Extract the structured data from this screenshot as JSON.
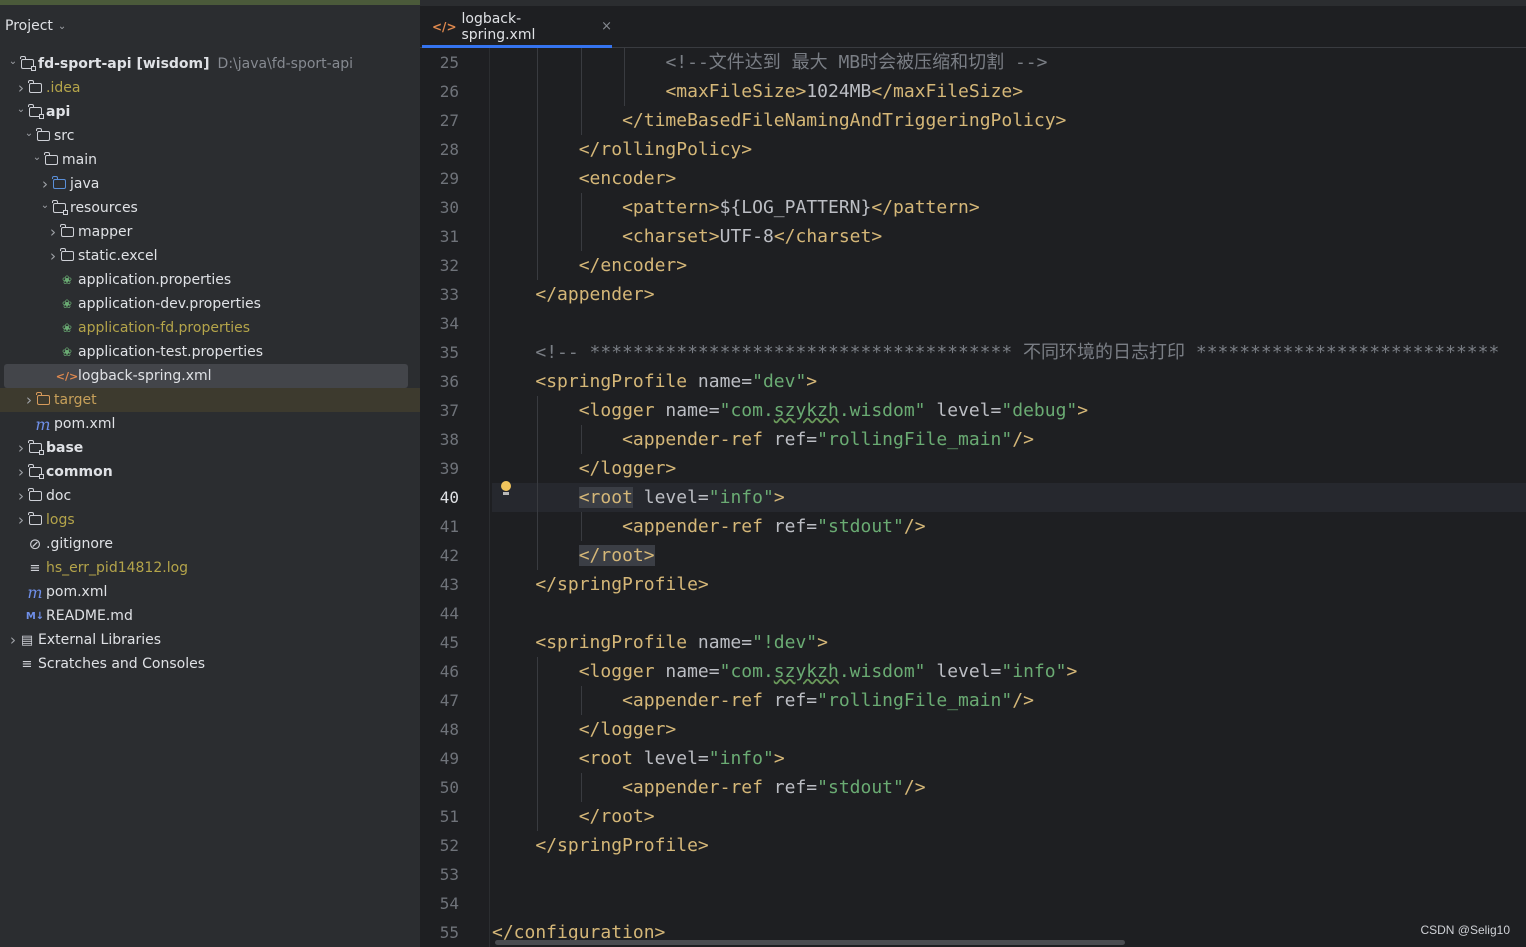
{
  "sidebar": {
    "header": "Project",
    "tree": [
      {
        "label": "fd-sport-api [wisdom]",
        "path": "D:\\java\\fd-sport-api",
        "depth": 0,
        "arrow": "open",
        "icon": "folder-module",
        "style": "bold-root"
      },
      {
        "label": ".idea",
        "depth": 1,
        "arrow": "closed",
        "icon": "folder",
        "style": "yellow"
      },
      {
        "label": "api",
        "depth": 1,
        "arrow": "open",
        "icon": "folder-module",
        "style": "bold"
      },
      {
        "label": "src",
        "depth": 2,
        "arrow": "open",
        "icon": "folder",
        "style": ""
      },
      {
        "label": "main",
        "depth": 3,
        "arrow": "open",
        "icon": "folder",
        "style": ""
      },
      {
        "label": "java",
        "depth": 4,
        "arrow": "closed",
        "icon": "folder-blue",
        "style": ""
      },
      {
        "label": "resources",
        "depth": 4,
        "arrow": "open",
        "icon": "folder-resources",
        "style": ""
      },
      {
        "label": "mapper",
        "depth": 5,
        "arrow": "closed",
        "icon": "folder",
        "style": ""
      },
      {
        "label": "static.excel",
        "depth": 5,
        "arrow": "closed",
        "icon": "folder",
        "style": ""
      },
      {
        "label": "application.properties",
        "depth": 5,
        "arrow": "none",
        "icon": "spring-leaf",
        "style": ""
      },
      {
        "label": "application-dev.properties",
        "depth": 5,
        "arrow": "none",
        "icon": "spring-leaf",
        "style": ""
      },
      {
        "label": "application-fd.properties",
        "depth": 5,
        "arrow": "none",
        "icon": "spring-leaf",
        "style": "yellow"
      },
      {
        "label": "application-test.properties",
        "depth": 5,
        "arrow": "none",
        "icon": "spring-leaf",
        "style": ""
      },
      {
        "label": "logback-spring.xml",
        "depth": 5,
        "arrow": "none",
        "icon": "xml",
        "style": "selected"
      },
      {
        "label": "target",
        "depth": 2,
        "arrow": "closed",
        "icon": "folder-orange",
        "style": "orange"
      },
      {
        "label": "pom.xml",
        "depth": 2,
        "arrow": "none",
        "icon": "maven",
        "style": ""
      },
      {
        "label": "base",
        "depth": 1,
        "arrow": "closed",
        "icon": "folder-module",
        "style": "bold"
      },
      {
        "label": "common",
        "depth": 1,
        "arrow": "closed",
        "icon": "folder-module",
        "style": "bold"
      },
      {
        "label": "doc",
        "depth": 1,
        "arrow": "closed",
        "icon": "folder",
        "style": ""
      },
      {
        "label": "logs",
        "depth": 1,
        "arrow": "closed",
        "icon": "folder",
        "style": "yellow"
      },
      {
        "label": ".gitignore",
        "depth": 1,
        "arrow": "none",
        "icon": "ignore",
        "style": ""
      },
      {
        "label": "hs_err_pid14812.log",
        "depth": 1,
        "arrow": "none",
        "icon": "log",
        "style": "yellow"
      },
      {
        "label": "pom.xml",
        "depth": 1,
        "arrow": "none",
        "icon": "maven",
        "style": ""
      },
      {
        "label": "README.md",
        "depth": 1,
        "arrow": "none",
        "icon": "markdown",
        "style": ""
      },
      {
        "label": "External Libraries",
        "depth": 0,
        "arrow": "closed",
        "icon": "libraries",
        "style": ""
      },
      {
        "label": "Scratches and Consoles",
        "depth": 0,
        "arrow": "none",
        "icon": "scratches",
        "style": ""
      }
    ]
  },
  "editor": {
    "tab_label": "logback-spring.xml",
    "tab_close": "×",
    "current_line": 40,
    "lines": [
      {
        "n": 25,
        "indent": 4,
        "tokens": [
          [
            "c",
            "<!--文件达到 最大 MB时会被压缩和切割 -->"
          ]
        ]
      },
      {
        "n": 26,
        "indent": 4,
        "tokens": [
          [
            "t",
            "<maxFileSize>"
          ],
          [
            "a",
            "1024MB"
          ],
          [
            "t",
            "</maxFileSize>"
          ]
        ]
      },
      {
        "n": 27,
        "indent": 3,
        "tokens": [
          [
            "t",
            "</timeBasedFileNamingAndTriggeringPolicy>"
          ]
        ]
      },
      {
        "n": 28,
        "indent": 2,
        "tokens": [
          [
            "t",
            "</rollingPolicy>"
          ]
        ]
      },
      {
        "n": 29,
        "indent": 2,
        "tokens": [
          [
            "t",
            "<encoder>"
          ]
        ]
      },
      {
        "n": 30,
        "indent": 3,
        "tokens": [
          [
            "t",
            "<pattern>"
          ],
          [
            "a",
            "${LOG_PATTERN}"
          ],
          [
            "t",
            "</pattern>"
          ]
        ]
      },
      {
        "n": 31,
        "indent": 3,
        "tokens": [
          [
            "t",
            "<charset>"
          ],
          [
            "a",
            "UTF-8"
          ],
          [
            "t",
            "</charset>"
          ]
        ]
      },
      {
        "n": 32,
        "indent": 2,
        "tokens": [
          [
            "t",
            "</encoder>"
          ]
        ]
      },
      {
        "n": 33,
        "indent": 1,
        "tokens": [
          [
            "t",
            "</appender>"
          ]
        ]
      },
      {
        "n": 34,
        "indent": 0,
        "tokens": []
      },
      {
        "n": 35,
        "indent": 1,
        "tokens": [
          [
            "c",
            "<!-- *************************************** 不同环境的日志打印 ****************************"
          ]
        ]
      },
      {
        "n": 36,
        "indent": 1,
        "tokens": [
          [
            "t",
            "<springProfile "
          ],
          [
            "a",
            "name="
          ],
          [
            "v",
            "\"dev\""
          ],
          [
            "t",
            ">"
          ]
        ]
      },
      {
        "n": 37,
        "indent": 2,
        "tokens": [
          [
            "t",
            "<logger "
          ],
          [
            "a",
            "name="
          ],
          [
            "v",
            "\"com."
          ],
          [
            "vs",
            "szykzh"
          ],
          [
            "v",
            ".wisdom\" "
          ],
          [
            "a",
            "level="
          ],
          [
            "v",
            "\"debug\""
          ],
          [
            "t",
            ">"
          ]
        ]
      },
      {
        "n": 38,
        "indent": 3,
        "tokens": [
          [
            "t",
            "<appender-ref "
          ],
          [
            "a",
            "ref="
          ],
          [
            "v",
            "\"rollingFile_main\""
          ],
          [
            "t",
            "/>"
          ]
        ]
      },
      {
        "n": 39,
        "indent": 2,
        "tokens": [
          [
            "t",
            "</logger>"
          ]
        ]
      },
      {
        "n": 40,
        "indent": 2,
        "tokens": [
          [
            "th",
            "<root"
          ],
          [
            "t",
            " "
          ],
          [
            "a",
            "level="
          ],
          [
            "v",
            "\"info\""
          ],
          [
            "t",
            ">"
          ]
        ]
      },
      {
        "n": 41,
        "indent": 3,
        "tokens": [
          [
            "t",
            "<appender-ref "
          ],
          [
            "a",
            "ref="
          ],
          [
            "v",
            "\"stdout\""
          ],
          [
            "t",
            "/>"
          ]
        ]
      },
      {
        "n": 42,
        "indent": 2,
        "tokens": [
          [
            "th",
            "</root>"
          ]
        ]
      },
      {
        "n": 43,
        "indent": 1,
        "tokens": [
          [
            "t",
            "</springProfile>"
          ]
        ]
      },
      {
        "n": 44,
        "indent": 0,
        "tokens": []
      },
      {
        "n": 45,
        "indent": 1,
        "tokens": [
          [
            "t",
            "<springProfile "
          ],
          [
            "a",
            "name="
          ],
          [
            "v",
            "\"!dev\""
          ],
          [
            "t",
            ">"
          ]
        ]
      },
      {
        "n": 46,
        "indent": 2,
        "tokens": [
          [
            "t",
            "<logger "
          ],
          [
            "a",
            "name="
          ],
          [
            "v",
            "\"com."
          ],
          [
            "vs",
            "szykzh"
          ],
          [
            "v",
            ".wisdom\" "
          ],
          [
            "a",
            "level="
          ],
          [
            "v",
            "\"info\""
          ],
          [
            "t",
            ">"
          ]
        ]
      },
      {
        "n": 47,
        "indent": 3,
        "tokens": [
          [
            "t",
            "<appender-ref "
          ],
          [
            "a",
            "ref="
          ],
          [
            "v",
            "\"rollingFile_main\""
          ],
          [
            "t",
            "/>"
          ]
        ]
      },
      {
        "n": 48,
        "indent": 2,
        "tokens": [
          [
            "t",
            "</logger>"
          ]
        ]
      },
      {
        "n": 49,
        "indent": 2,
        "tokens": [
          [
            "t",
            "<root "
          ],
          [
            "a",
            "level="
          ],
          [
            "v",
            "\"info\""
          ],
          [
            "t",
            ">"
          ]
        ]
      },
      {
        "n": 50,
        "indent": 3,
        "tokens": [
          [
            "t",
            "<appender-ref "
          ],
          [
            "a",
            "ref="
          ],
          [
            "v",
            "\"stdout\""
          ],
          [
            "t",
            "/>"
          ]
        ]
      },
      {
        "n": 51,
        "indent": 2,
        "tokens": [
          [
            "t",
            "</root>"
          ]
        ]
      },
      {
        "n": 52,
        "indent": 1,
        "tokens": [
          [
            "t",
            "</springProfile>"
          ]
        ]
      },
      {
        "n": 53,
        "indent": 0,
        "tokens": []
      },
      {
        "n": 54,
        "indent": 0,
        "tokens": []
      },
      {
        "n": 55,
        "indent": 0,
        "tokens": [
          [
            "t",
            "</configuration>"
          ]
        ]
      }
    ]
  },
  "watermark": "CSDN @Selig10"
}
